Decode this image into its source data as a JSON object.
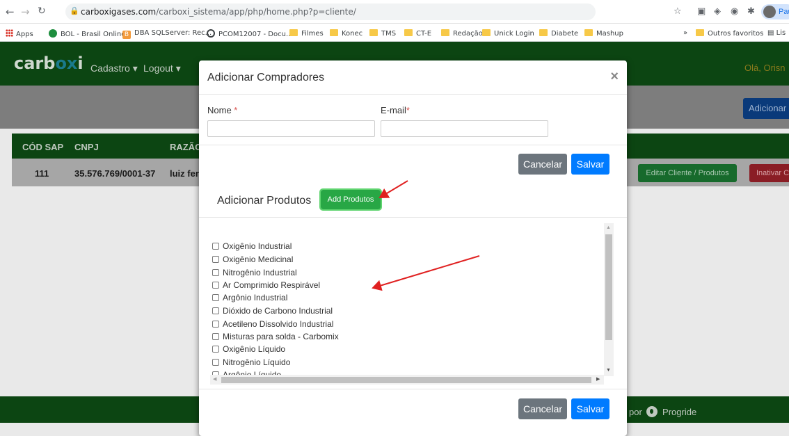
{
  "browser": {
    "url_host": "carboxigases.com",
    "url_path": "/carboxi_sistema/app/php/home.php?p=cliente/",
    "profile_name": "Pau",
    "bookmarks": [
      "Apps",
      "BOL - Brasil Online",
      "DBA SQLServer: Rec...",
      "PCOM12007 - Docu...",
      "Filmes",
      "Konec",
      "TMS",
      "CT-E",
      "Redação",
      "Unick Login",
      "Diabete",
      "Mashup"
    ],
    "bookmarks_overflow": "»",
    "other_bookmarks": "Outros favoritos",
    "reading_list": "Lis"
  },
  "app": {
    "logo_prefix": "carb",
    "logo_mid": "ox",
    "logo_suffix": "i",
    "menu": [
      "Cadastro ▾",
      "Logout ▾"
    ],
    "greeting": "Olá, Orisn",
    "add_button": "Adicionar C",
    "table_headers": [
      "CÓD SAP",
      "CNPJ",
      "RAZÃO"
    ],
    "row": {
      "cod_sap": "111",
      "cnpj": "35.576.769/0001-37",
      "razao": "luiz fer",
      "edit_button": "Editar Cliente / Produtos",
      "inactivate_button": "Inativar C"
    },
    "footer_prefix": "por",
    "footer_brand": "Progride"
  },
  "modal": {
    "title": "Adicionar Compradores",
    "close": "×",
    "name_label": "Nome ",
    "email_label": "E-mail",
    "required_mark": "*",
    "name_value": "",
    "email_value": "",
    "cancel": "Cancelar",
    "save": "Salvar",
    "products_title": "Adicionar Produtos",
    "add_products_button": "Add Produtos",
    "products": [
      "Oxigênio Industrial",
      "Oxigênio Medicinal",
      "Nitrogênio Industrial",
      "Ar Comprimido Respirável",
      "Argônio Industrial",
      "Dióxido de Carbono Industrial",
      "Acetileno Dissolvido Industrial",
      "Misturas para solda - Carbomix",
      "Oxigênio Líquido",
      "Nitrogênio Líquido",
      "Argônio Líquido"
    ]
  },
  "colors": {
    "header_green": "#0c4512",
    "primary_blue": "#007bff",
    "success_green": "#28a745",
    "secondary_gray": "#6c757d",
    "annotation_red": "#e02020"
  }
}
